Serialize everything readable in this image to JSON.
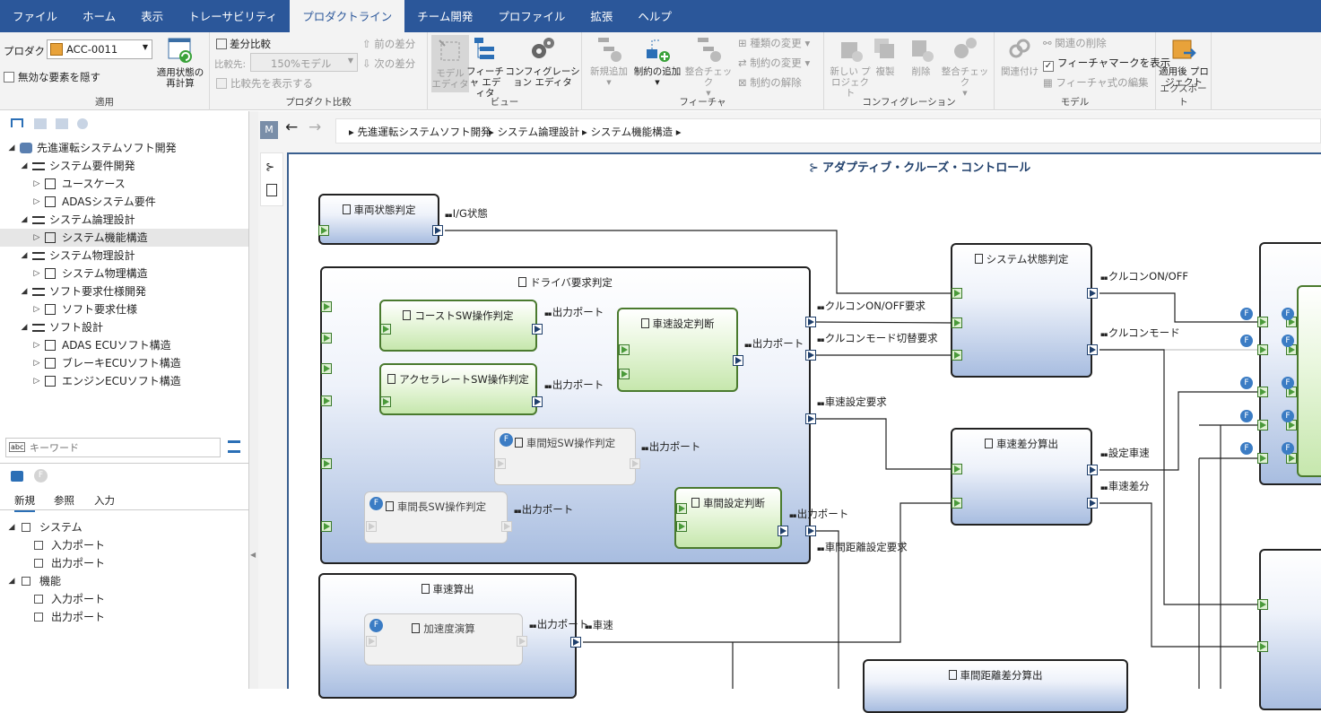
{
  "menubar": {
    "tabs": [
      {
        "label": "ファイル",
        "active": false
      },
      {
        "label": "ホーム",
        "active": false
      },
      {
        "label": "表示",
        "active": false
      },
      {
        "label": "トレーサビリティ",
        "active": false
      },
      {
        "label": "プロダクトライン",
        "active": true
      },
      {
        "label": "チーム開発",
        "active": false
      },
      {
        "label": "プロファイル",
        "active": false
      },
      {
        "label": "拡張",
        "active": false
      },
      {
        "label": "ヘルプ",
        "active": false
      }
    ]
  },
  "ribbon": {
    "apply": {
      "product_label": "プロダクト:",
      "product_value": "ACC-0011",
      "hide_invalid": "無効な要素を隠す",
      "recalc": "適用状態の再計算",
      "group": "適用"
    },
    "compare": {
      "diff": "差分比較",
      "compare_to": "比較先:",
      "compare_value": "150%モデル",
      "show_target": "比較先を表示する",
      "prev": "前の差分",
      "next": "次の差分",
      "group": "プロダクト比較"
    },
    "view": {
      "model_editor": "モデル エディタ",
      "feature_editor": "フィーチャ エディタ",
      "config_editor": "コンフィグレーション エディタ",
      "group": "ビュー"
    },
    "feature": {
      "new": "新規追加",
      "constraint_add": "制約の追加",
      "check": "整合チェック",
      "type_change": "種類の変更",
      "constraint_change": "制約の変更",
      "constraint_remove": "制約の解除",
      "group": "フィーチャ"
    },
    "config": {
      "new_project": "新しい プロジェクト",
      "copy": "複製",
      "delete": "削除",
      "check": "整合チェック",
      "group": "コンフィグレーション"
    },
    "model": {
      "link": "関連付け",
      "unlink": "関連の削除",
      "show_mark": "フィーチャマークを表示",
      "edit_formula": "フィーチャ式の編集",
      "group": "モデル"
    },
    "export": {
      "after_project": "適用後 プロジェクト",
      "group": "エクスポート"
    }
  },
  "tree": {
    "items": [
      {
        "label": "先進運転システムソフト開発",
        "level": 0,
        "expanded": true,
        "icon": "project-icon"
      },
      {
        "label": "システム要件開発",
        "level": 1,
        "expanded": true,
        "icon": "package-icon"
      },
      {
        "label": "ユースケース",
        "level": 2,
        "expanded": false,
        "icon": "diagram-icon"
      },
      {
        "label": "ADASシステム要件",
        "level": 2,
        "expanded": false,
        "icon": "diagram-icon"
      },
      {
        "label": "システム論理設計",
        "level": 1,
        "expanded": true,
        "icon": "package-icon"
      },
      {
        "label": "システム機能構造",
        "level": 2,
        "expanded": false,
        "icon": "diagram-icon",
        "selected": true
      },
      {
        "label": "システム物理設計",
        "level": 1,
        "expanded": true,
        "icon": "package-icon"
      },
      {
        "label": "システム物理構造",
        "level": 2,
        "expanded": false,
        "icon": "diagram-icon"
      },
      {
        "label": "ソフト要求仕様開発",
        "level": 1,
        "expanded": true,
        "icon": "package-icon"
      },
      {
        "label": "ソフト要求仕様",
        "level": 2,
        "expanded": false,
        "icon": "diagram-icon"
      },
      {
        "label": "ソフト設計",
        "level": 1,
        "expanded": true,
        "icon": "package-icon"
      },
      {
        "label": "ADAS ECUソフト構造",
        "level": 2,
        "expanded": false,
        "icon": "diagram-icon"
      },
      {
        "label": "ブレーキECUソフト構造",
        "level": 2,
        "expanded": false,
        "icon": "diagram-icon"
      },
      {
        "label": "エンジンECUソフト構造",
        "level": 2,
        "expanded": false,
        "icon": "diagram-icon"
      }
    ]
  },
  "search": {
    "placeholder": "キーワード"
  },
  "palette": {
    "tabs": [
      "新規",
      "参照",
      "入力"
    ],
    "items": [
      {
        "label": "システム",
        "level": 0
      },
      {
        "label": "入力ポート",
        "level": 1
      },
      {
        "label": "出力ポート",
        "level": 1
      },
      {
        "label": "機能",
        "level": 0
      },
      {
        "label": "入力ポート",
        "level": 1
      },
      {
        "label": "出力ポート",
        "level": 1
      }
    ]
  },
  "breadcrumb": {
    "m": "M",
    "items": [
      "先進運転システムソフト開発",
      "システム論理設計",
      "システム機能構造"
    ]
  },
  "diagram": {
    "title": "アダプティブ・クルーズ・コントロール",
    "blocks": {
      "vehicle_state": "車両状態判定",
      "driver_req": "ドライバ要求判定",
      "coast_sw": "コーストSW操作判定",
      "accel_sw": "アクセラレートSW操作判定",
      "speed_set": "車速設定判断",
      "gap_short": "車間短SW操作判定",
      "gap_long": "車間長SW操作判定",
      "gap_set": "車間設定判断",
      "system_state": "システム状態判定",
      "speed_diff": "車速差分算出",
      "speed_calc": "車速算出",
      "accel_calc": "加速度演算",
      "gap_diff": "車間距離差分算出"
    },
    "ports": {
      "ig": "I/G状態",
      "out": "出力ポート",
      "cc_onoff_req": "クルコンON/OFF要求",
      "cc_mode_req": "クルコンモード切替要求",
      "speed_set_req": "車速設定要求",
      "gap_set_req": "車間距離設定要求",
      "cc_onoff": "クルコンON/OFF",
      "cc_mode": "クルコンモード",
      "set_speed": "設定車速",
      "speed_diff": "車速差分",
      "speed": "車速"
    },
    "feature_mark": "F"
  },
  "colors": {
    "menubar": "#2b579a",
    "accent": "#2b579a",
    "feature": "#3b7cc4",
    "block_border": "#222222"
  }
}
